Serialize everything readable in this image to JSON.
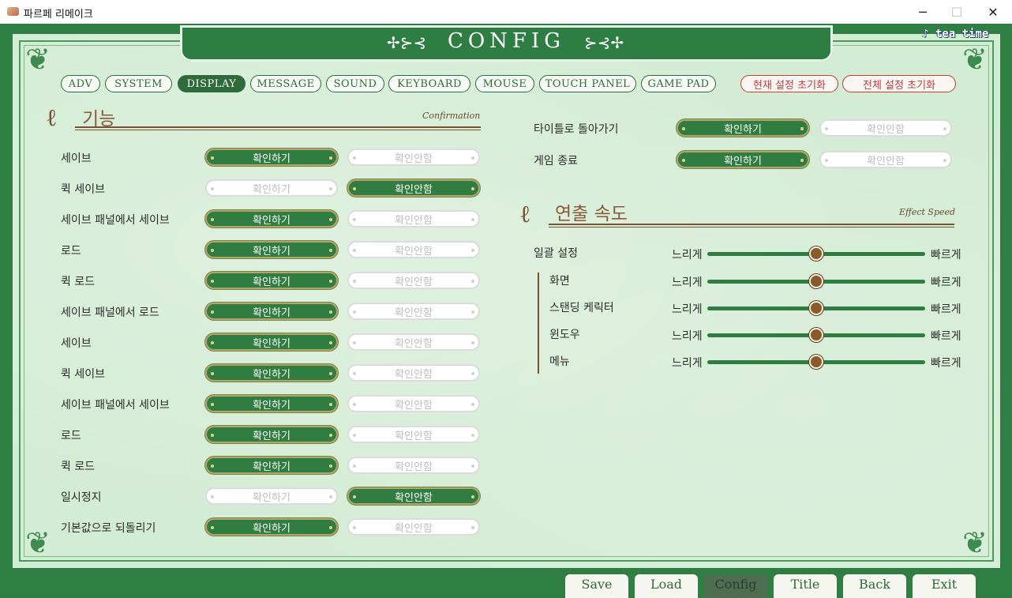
{
  "window": {
    "title": "파르페 리메이크",
    "minimize": "─",
    "maximize": "☐",
    "close": "✕"
  },
  "header": {
    "title": "CONFIG",
    "orn_left": "✢⊱⊰",
    "orn_right": "⊱⊰✢",
    "logo": "♪ tea time"
  },
  "tabs": [
    "ADV",
    "SYSTEM",
    "DISPLAY",
    "MESSAGE",
    "SOUND",
    "KEYBOARD",
    "MOUSE",
    "TOUCH PANEL",
    "GAME PAD"
  ],
  "active_tab": "DISPLAY",
  "reset": {
    "current": "현재 설정 초기화",
    "all": "전체 설정 초기화"
  },
  "confirm_section": {
    "title": "기능",
    "subtitle": "Confirmation",
    "on_label": "확인하기",
    "off_label": "확인안함",
    "rows": [
      {
        "label": "세이브",
        "value": "on"
      },
      {
        "label": "퀵 세이브",
        "value": "off"
      },
      {
        "label": "세이브 패널에서 세이브",
        "value": "on"
      },
      {
        "label": "로드",
        "value": "on"
      },
      {
        "label": "퀵 로드",
        "value": "on"
      },
      {
        "label": "세이브 패널에서 로드",
        "value": "on"
      },
      {
        "label": "세이브",
        "value": "on"
      },
      {
        "label": "퀵 세이브",
        "value": "on"
      },
      {
        "label": "세이브 패널에서 세이브",
        "value": "on"
      },
      {
        "label": "로드",
        "value": "on"
      },
      {
        "label": "퀵 로드",
        "value": "on"
      },
      {
        "label": "일시정지",
        "value": "off"
      },
      {
        "label": "기본값으로 되돌리기",
        "value": "on"
      }
    ],
    "right_rows": [
      {
        "label": "타이틀로 돌아가기",
        "value": "on"
      },
      {
        "label": "게임 종료",
        "value": "on"
      }
    ]
  },
  "effect_section": {
    "title": "연출 속도",
    "subtitle": "Effect Speed",
    "slow": "느리게",
    "fast": "빠르게",
    "sliders": [
      {
        "label": "일괄 설정",
        "value": 0.5
      },
      {
        "label": "화면",
        "value": 0.5
      },
      {
        "label": "스탠딩 케릭터",
        "value": 0.5
      },
      {
        "label": "윈도우",
        "value": 0.5
      },
      {
        "label": "메뉴",
        "value": 0.5
      }
    ]
  },
  "bottom_nav": [
    "Save",
    "Load",
    "Config",
    "Title",
    "Back",
    "Exit"
  ],
  "active_nav": "Config"
}
